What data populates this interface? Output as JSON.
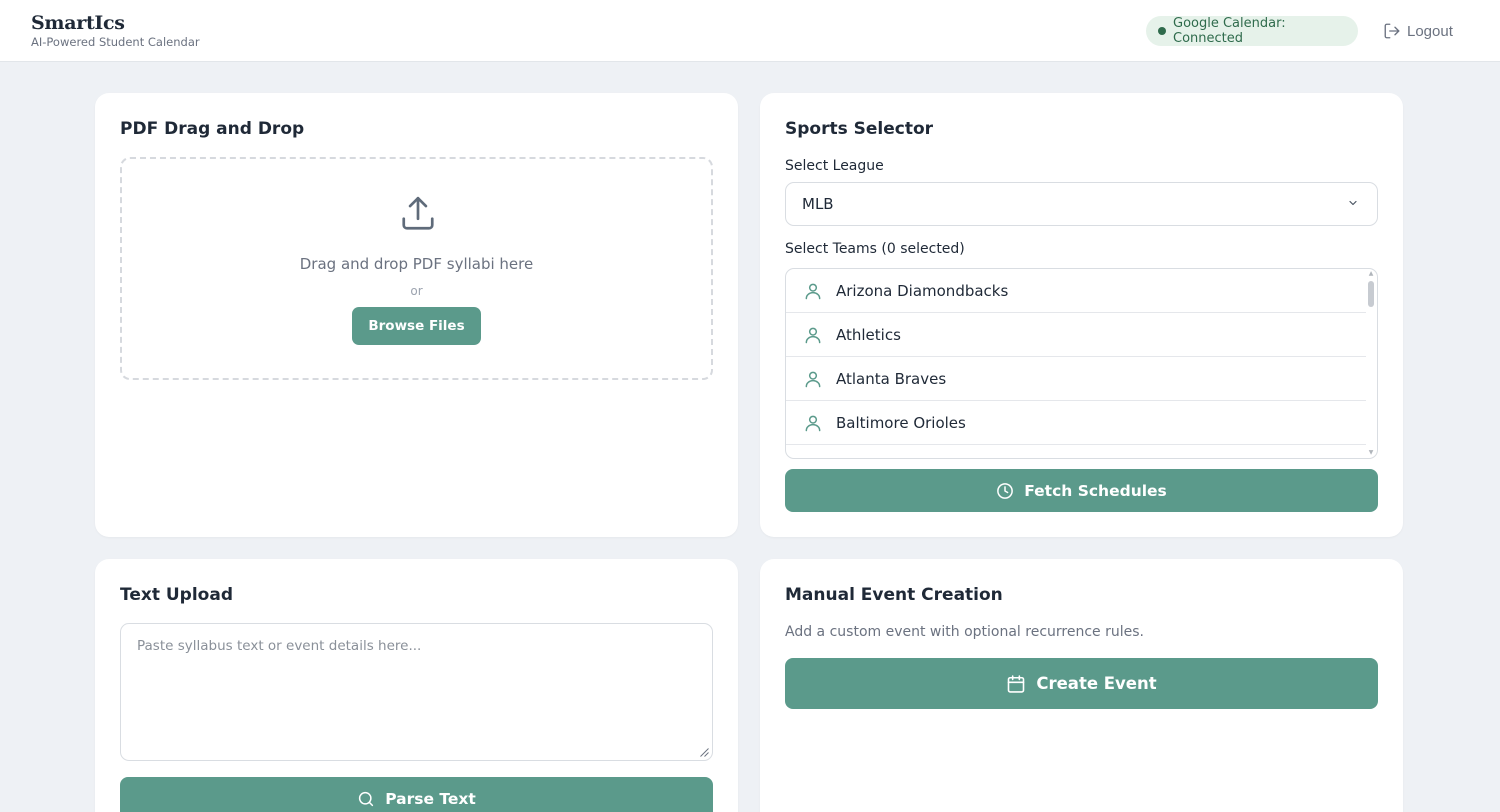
{
  "header": {
    "brand_name": "SmartIcs",
    "tagline": "AI-Powered Student Calendar",
    "gcal_status": "Google Calendar: Connected",
    "logout_label": "Logout"
  },
  "pdf_card": {
    "title": "PDF Drag and Drop",
    "drop_text": "Drag and drop PDF syllabi here",
    "or_text": "or",
    "browse_label": "Browse Files"
  },
  "sports_card": {
    "title": "Sports Selector",
    "league_label": "Select League",
    "league_value": "MLB",
    "teams_label": "Select Teams (0 selected)",
    "teams": [
      {
        "name": "Arizona Diamondbacks"
      },
      {
        "name": "Athletics"
      },
      {
        "name": "Atlanta Braves"
      },
      {
        "name": "Baltimore Orioles"
      }
    ],
    "fetch_label": "Fetch Schedules"
  },
  "text_card": {
    "title": "Text Upload",
    "placeholder": "Paste syllabus text or event details here...",
    "parse_label": "Parse Text"
  },
  "manual_card": {
    "title": "Manual Event Creation",
    "description": "Add a custom event with optional recurrence rules.",
    "create_label": "Create Event"
  },
  "colors": {
    "accent": "#5b9a8b",
    "background": "#eef1f5",
    "status_green": "#2f6b4c",
    "status_bg": "#e6f2ea"
  },
  "icons": {
    "upload": "upload-icon",
    "user": "user-icon",
    "clock": "clock-icon",
    "search": "search-icon",
    "calendar": "calendar-icon",
    "logout": "logout-icon",
    "chevron": "chevron-down-icon"
  }
}
